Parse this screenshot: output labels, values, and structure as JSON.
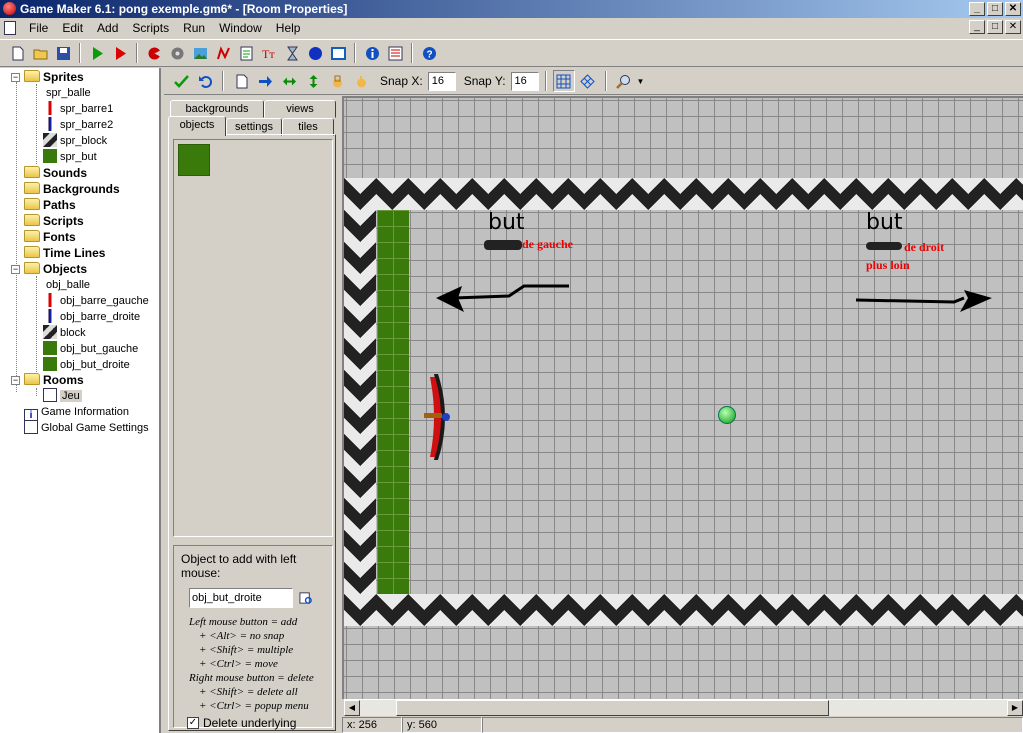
{
  "window": {
    "title": "Game Maker 6.1: pong exemple.gm6* - [Room Properties]",
    "min": "_",
    "max": "□",
    "close": "✕"
  },
  "menu": [
    "File",
    "Edit",
    "Add",
    "Scripts",
    "Run",
    "Window",
    "Help"
  ],
  "tree": {
    "groups": {
      "sprites": "Sprites",
      "sounds": "Sounds",
      "backgrounds": "Backgrounds",
      "paths": "Paths",
      "scripts": "Scripts",
      "fonts": "Fonts",
      "timelines": "Time Lines",
      "objects": "Objects",
      "rooms": "Rooms"
    },
    "sprites": [
      "spr_balle",
      "spr_barre1",
      "spr_barre2",
      "spr_block",
      "spr_but"
    ],
    "objects": [
      "obj_balle",
      "obj_barre_gauche",
      "obj_barre_droite",
      "block",
      "obj_but_gauche",
      "obj_but_droite"
    ],
    "rooms": [
      "Jeu"
    ],
    "game_information": "Game Information",
    "global_settings": "Global Game Settings"
  },
  "room_toolbar": {
    "snap_x_label": "Snap X:",
    "snap_x": "16",
    "snap_y_label": "Snap Y:",
    "snap_y": "16"
  },
  "tabs": {
    "backgrounds": "backgrounds",
    "views": "views",
    "objects": "objects",
    "settings": "settings",
    "tiles": "tiles"
  },
  "add_panel": {
    "title": "Object to add with left mouse:",
    "object": "obj_but_droite",
    "help": {
      "l1": "Left mouse button = add",
      "l2": "+ <Alt> = no snap",
      "l3": "+ <Shift> = multiple",
      "l4": "+ <Ctrl> = move",
      "l5": "Right mouse button = delete",
      "l6": "+ <Shift> = delete all",
      "l7": "+ <Ctrl> = popup menu"
    },
    "delete_underlying": "Delete underlying",
    "delete_checked": "✓"
  },
  "canvas": {
    "left_note_title": "but",
    "left_note_text": "de gauche",
    "right_note_title": "but",
    "right_note_text": "de droit",
    "right_note_text2": "plus loin"
  },
  "status": {
    "x": "x: 256",
    "y": "y: 560"
  },
  "colors": {
    "title_bar": "#0a246a",
    "goal_green": "#3a7a0a",
    "annotation_red": "#e00000"
  }
}
